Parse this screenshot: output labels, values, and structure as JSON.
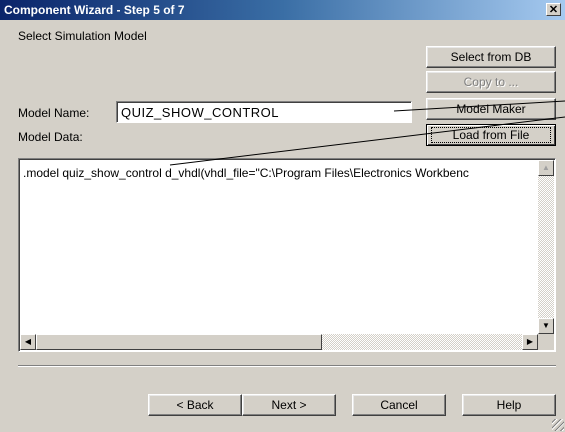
{
  "window": {
    "title": "Component Wizard - Step 5 of 7",
    "close_glyph": "✕"
  },
  "section_label": "Select Simulation Model",
  "model_name": {
    "label": "Model Name:",
    "value": "QUIZ_SHOW_CONTROL"
  },
  "model_data": {
    "label": "Model Data:",
    "text": ".model quiz_show_control d_vhdl(vhdl_file=\"C:\\Program Files\\Electronics Workbenc"
  },
  "side_buttons": {
    "select_from_db": "Select from DB",
    "copy_to": "Copy to ...",
    "model_maker": "Model Maker",
    "load_from_file": "Load from File"
  },
  "footer_buttons": {
    "back": "< Back",
    "next": "Next >",
    "cancel": "Cancel",
    "help": "Help"
  },
  "colors": {
    "title_bar_start": "#0a246a",
    "title_bar_end": "#a6caf0",
    "dialog_face": "#d4d0c8"
  },
  "icons": {
    "close": "close-icon",
    "scroll_up": "arrow-up-icon",
    "scroll_down": "arrow-down-icon",
    "scroll_left": "arrow-left-icon",
    "scroll_right": "arrow-right-icon"
  }
}
